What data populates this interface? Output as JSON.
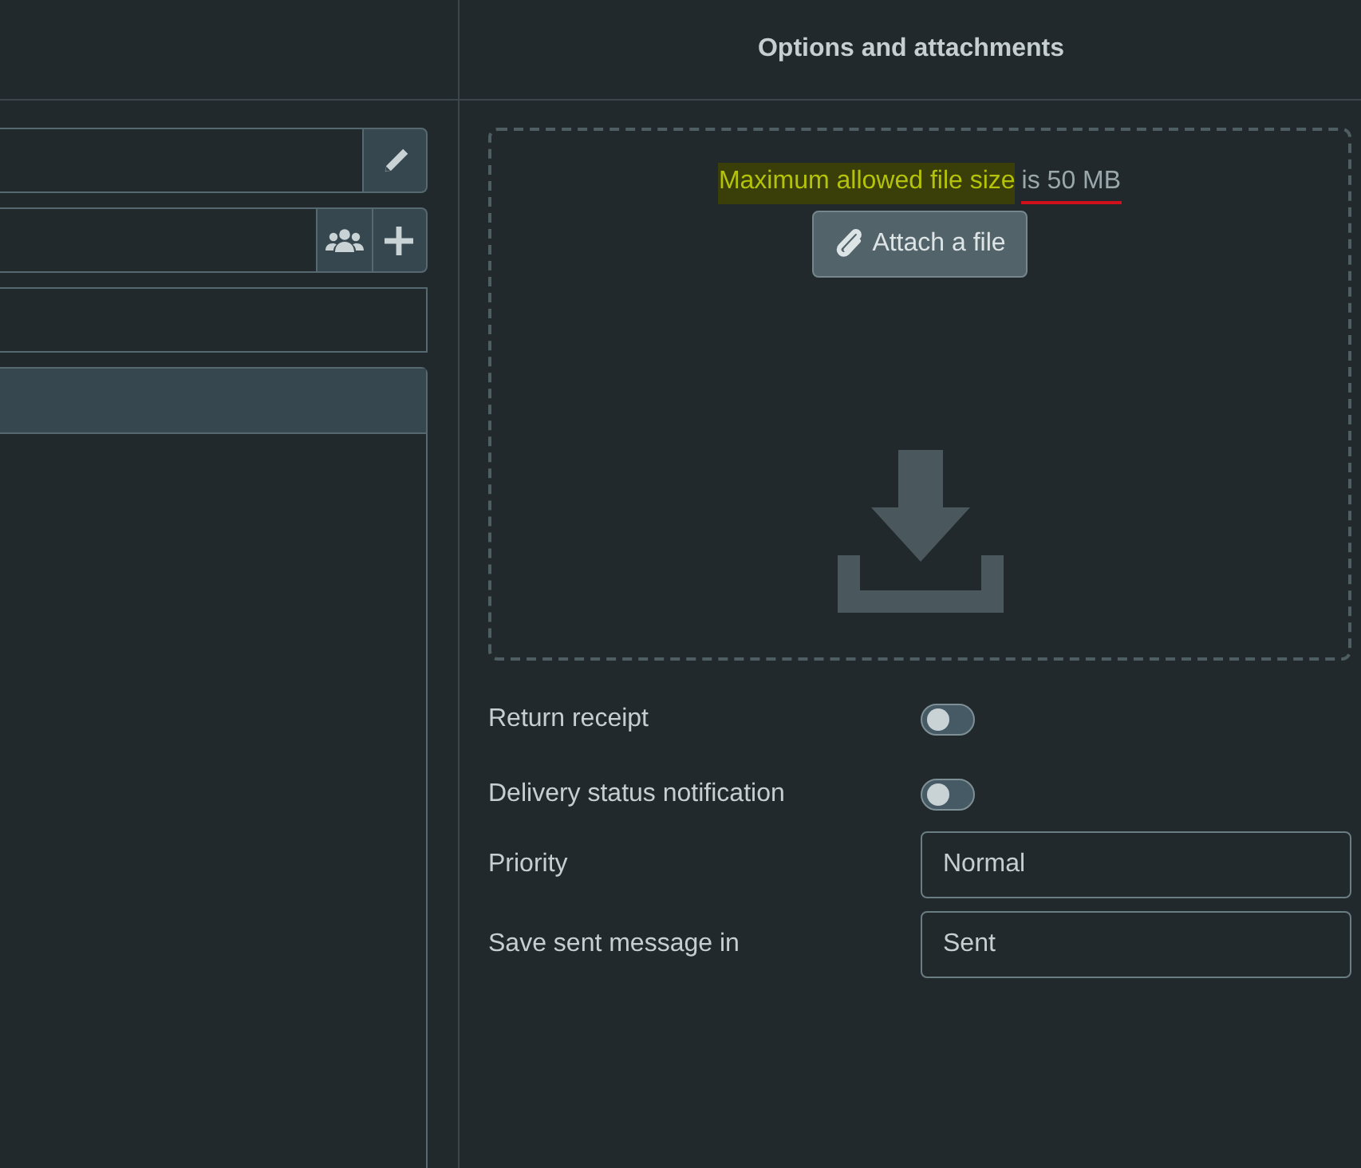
{
  "panel": {
    "title": "Options and attachments"
  },
  "compose_fields": [
    {
      "kind": "edit"
    },
    {
      "kind": "contacts"
    },
    {
      "kind": "plain"
    }
  ],
  "attachments": {
    "notice": [
      {
        "text": "Maximum allowed file size",
        "highlighted": true,
        "underlined": false
      },
      {
        "text": "is 50 MB",
        "highlighted": false,
        "underlined": true
      }
    ],
    "button": "Attach a file"
  },
  "options": [
    {
      "kind": "toggle",
      "label": "Return receipt",
      "on": false
    },
    {
      "kind": "toggle",
      "label": "Delivery status notification",
      "on": false
    },
    {
      "kind": "select",
      "label": "Priority",
      "value": "Normal"
    },
    {
      "kind": "select",
      "label": "Save sent message in",
      "value": "Sent"
    }
  ]
}
